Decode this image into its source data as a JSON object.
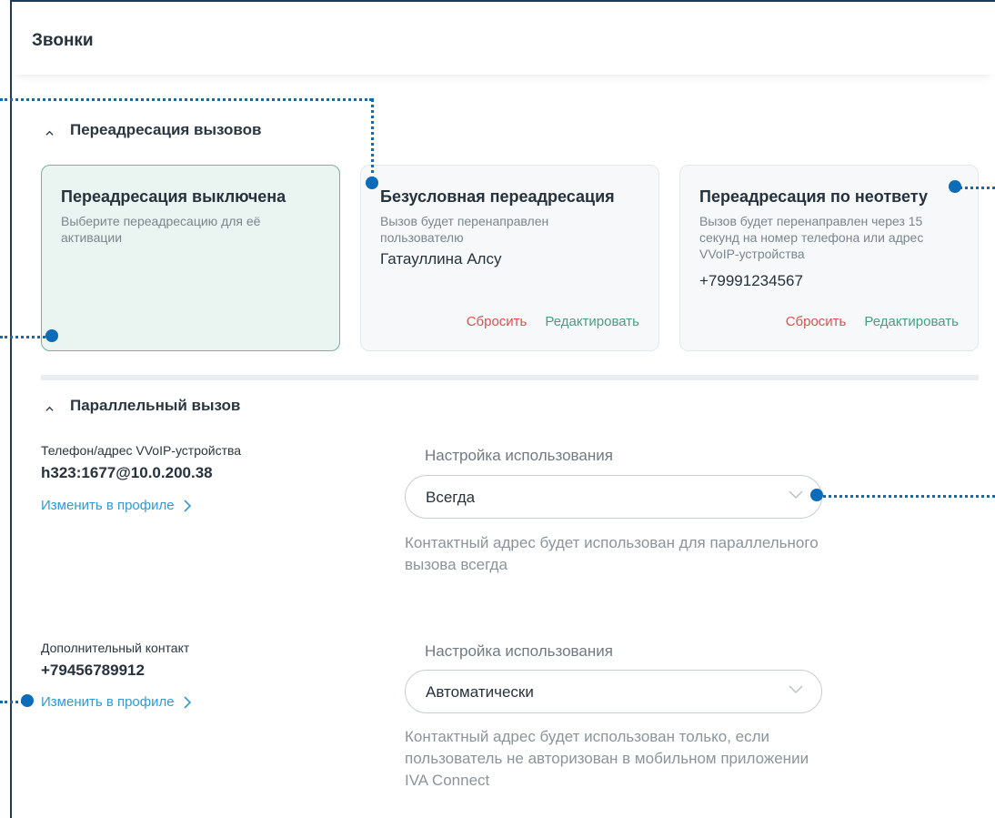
{
  "header": {
    "title": "Звонки"
  },
  "forwarding": {
    "section_title": "Переадресация вызовов",
    "cards": [
      {
        "title": "Переадресация выключена",
        "description": "Выберите переадресацию для её активации",
        "value": "",
        "active": true
      },
      {
        "title": "Безусловная переадресация",
        "description": "Вызов будет перенаправлен пользователю",
        "value": "Гатауллина Алсу",
        "reset_label": "Сбросить",
        "edit_label": "Редактировать"
      },
      {
        "title": "Переадресация по неответу",
        "description": "Вызов будет перенаправлен через 15 секунд на номер телефона или адрес VVoIP-устройства",
        "value": "+79991234567",
        "reset_label": "Сбросить",
        "edit_label": "Редактировать"
      }
    ]
  },
  "parallel": {
    "section_title": "Параллельный вызов",
    "rows": [
      {
        "label": "Телефон/адрес VVoIP-устройства",
        "value": "h323:1677@10.0.200.38",
        "link": "Изменить в профиле",
        "usage_label": "Настройка использования",
        "select_value": "Всегда",
        "hint": "Контактный адрес будет использован для параллельного вызова всегда"
      },
      {
        "label": "Дополнительный контакт",
        "value": "+79456789912",
        "link": "Изменить в профиле",
        "usage_label": "Настройка использования",
        "select_value": "Автоматически",
        "hint": "Контактный адрес будет использован только, если пользователь не авторизован в мобильном приложении IVA Connect"
      }
    ]
  },
  "colors": {
    "accent_green": "#4a9d82",
    "danger": "#d9534f",
    "link": "#2e9ad6",
    "callout": "#0d6cba"
  }
}
